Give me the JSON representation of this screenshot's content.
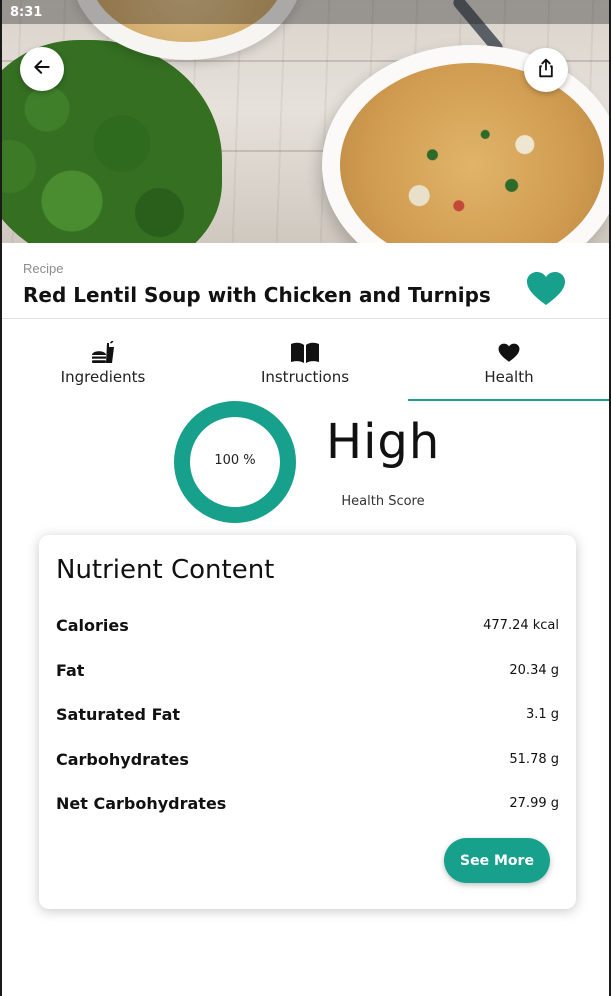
{
  "status_bar": {
    "time": "8:31"
  },
  "header": {
    "label": "Recipe",
    "title": "Red Lentil Soup with Chicken and Turnips",
    "favorite_icon": "heart-icon",
    "favorited": true
  },
  "navigation": {
    "back_icon": "arrow-left-icon",
    "share_icon": "share-icon"
  },
  "tabs": [
    {
      "label": "Ingredients",
      "icon": "fast-food-icon",
      "active": false
    },
    {
      "label": "Instructions",
      "icon": "open-book-icon",
      "active": false
    },
    {
      "label": "Health",
      "icon": "heart-icon",
      "active": true
    }
  ],
  "health": {
    "percent_label": "100 %",
    "percent_value": 100,
    "score_word": "High",
    "caption": "Health Score"
  },
  "nutrients": {
    "title": "Nutrient Content",
    "items": [
      {
        "name": "Calories",
        "value": "477.24 kcal"
      },
      {
        "name": "Fat",
        "value": "20.34 g"
      },
      {
        "name": "Saturated Fat",
        "value": "3.1 g"
      },
      {
        "name": "Carbohydrates",
        "value": "51.78 g"
      },
      {
        "name": "Net Carbohydrates",
        "value": "27.99 g"
      }
    ],
    "see_more_label": "See More"
  },
  "colors": {
    "accent": "#17a08b",
    "text": "#111111",
    "muted": "#8c8c8c"
  }
}
